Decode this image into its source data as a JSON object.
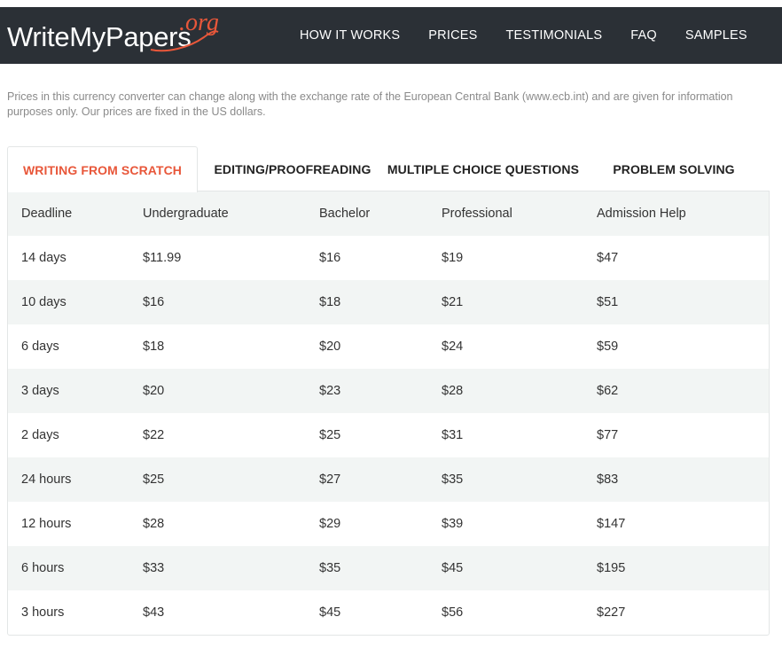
{
  "brand": {
    "name": "WriteMyPapers",
    "suffix": ".org"
  },
  "nav": [
    "HOW IT WORKS",
    "PRICES",
    "TESTIMONIALS",
    "FAQ",
    "SAMPLES"
  ],
  "note": "Prices in this currency converter can change along with the exchange rate of the European Central Bank (www.ecb.int) and are given for information purposes only. Our prices are fixed in the US dollars.",
  "tabs": [
    "WRITING FROM SCRATCH",
    "EDITING/PROOFREADING",
    "MULTIPLE CHOICE QUESTIONS",
    "PROBLEM SOLVING"
  ],
  "active_tab": "WRITING FROM SCRATCH",
  "table": {
    "headers": [
      "Deadline",
      "Undergraduate",
      "Bachelor",
      "Professional",
      "Admission Help"
    ],
    "rows": [
      [
        "14 days",
        "$11.99",
        "$16",
        "$19",
        "$47"
      ],
      [
        "10 days",
        "$16",
        "$18",
        "$21",
        "$51"
      ],
      [
        "6 days",
        "$18",
        "$20",
        "$24",
        "$59"
      ],
      [
        "3 days",
        "$20",
        "$23",
        "$28",
        "$62"
      ],
      [
        "2 days",
        "$22",
        "$25",
        "$31",
        "$77"
      ],
      [
        "24 hours",
        "$25",
        "$27",
        "$35",
        "$83"
      ],
      [
        "12 hours",
        "$28",
        "$29",
        "$39",
        "$147"
      ],
      [
        "6 hours",
        "$33",
        "$35",
        "$45",
        "$195"
      ],
      [
        "3 hours",
        "$43",
        "$45",
        "$56",
        "$227"
      ]
    ]
  },
  "colors": {
    "header_bg": "#2b3036",
    "accent": "#e8573a",
    "row_shade": "#f2f5f4"
  }
}
